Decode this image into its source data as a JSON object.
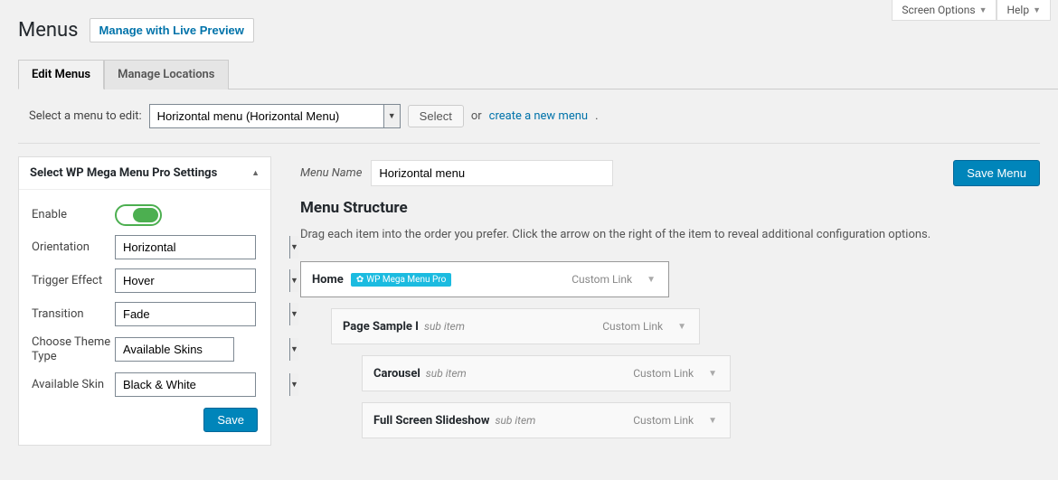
{
  "top": {
    "screen_options": "Screen Options",
    "help": "Help"
  },
  "header": {
    "title": "Menus",
    "live_preview": "Manage with Live Preview"
  },
  "tabs": {
    "edit": "Edit Menus",
    "locations": "Manage Locations"
  },
  "select_bar": {
    "label": "Select a menu to edit:",
    "value": "Horizontal menu (Horizontal Menu)",
    "select_btn": "Select",
    "or": "or",
    "create_link": "create a new menu"
  },
  "settings": {
    "heading": "Select WP Mega Menu Pro Settings",
    "enable_label": "Enable",
    "orientation_label": "Orientation",
    "orientation_value": "Horizontal",
    "trigger_label": "Trigger Effect",
    "trigger_value": "Hover",
    "transition_label": "Transition",
    "transition_value": "Fade",
    "theme_type_label": "Choose Theme Type",
    "theme_type_value": "Available Skins",
    "skin_label": "Available Skin",
    "skin_value": "Black & White",
    "save": "Save"
  },
  "menu_name": {
    "label": "Menu Name",
    "value": "Horizontal menu",
    "save": "Save Menu"
  },
  "structure": {
    "heading": "Menu Structure",
    "desc": "Drag each item into the order you prefer. Click the arrow on the right of the item to reveal additional configuration options."
  },
  "badge": "WP Mega Menu Pro",
  "items": [
    {
      "title": "Home",
      "sub": "",
      "type": "Custom Link"
    },
    {
      "title": "Page Sample I",
      "sub": "sub item",
      "type": "Custom Link"
    },
    {
      "title": "Carousel",
      "sub": "sub item",
      "type": "Custom Link"
    },
    {
      "title": "Full Screen Slideshow",
      "sub": "sub item",
      "type": "Custom Link"
    }
  ]
}
